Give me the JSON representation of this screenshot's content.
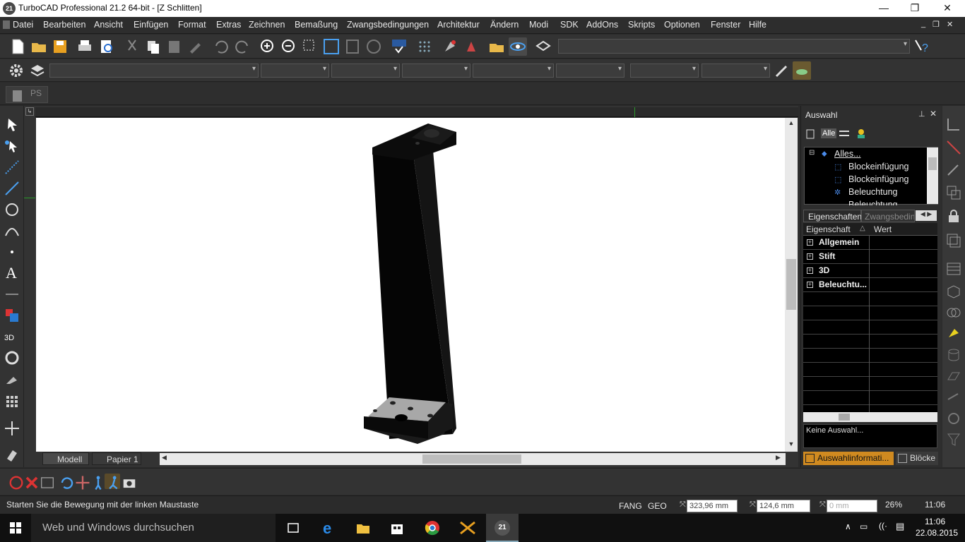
{
  "window": {
    "title": "TurboCAD Professional 21.2 64-bit - [Z Schlitten]",
    "app_icon_text": "21"
  },
  "menu": [
    "Datei",
    "Bearbeiten",
    "Ansicht",
    "Einfügen",
    "Format",
    "Extras",
    "Zeichnen",
    "Bemaßung",
    "Zwangsbedingungen",
    "Architektur",
    "Ändern",
    "Modi",
    "SDK",
    "AddOns",
    "Skripts",
    "Optionen",
    "Fenster",
    "Hilfe"
  ],
  "toolbar3": {
    "ps_label": "PS"
  },
  "tabs": {
    "model": "Modell",
    "paper": "Papier 1"
  },
  "panel": {
    "title": "Auswahl",
    "filter_label": "Alle",
    "tree": [
      "Alles...",
      "Blockeinfügung",
      "Blockeinfügung",
      "Beleuchtung",
      "Beleuchtung"
    ],
    "prop_tabs": [
      "Eigenschaften",
      "Zwangsbeding"
    ],
    "col_property": "Eigenschaft",
    "col_value": "Wert",
    "groups": [
      "Allgemein",
      "Stift",
      "3D",
      "Beleuchtu..."
    ],
    "info_text": "Keine Auswahl...",
    "bottom_tab_info": "Auswahlinformati...",
    "bottom_tab_blocks": "Blöcke"
  },
  "status": {
    "message": "Starten Sie die Bewegung mit der linken Maustaste",
    "snap": "FANG",
    "geo": "GEO",
    "x": "323,96 mm",
    "y": "124,6 mm",
    "z": "0 mm",
    "zoom": "26%",
    "time": "11:06"
  },
  "taskbar": {
    "search_placeholder": "Web und Windows durchsuchen",
    "clock_time": "11:06",
    "clock_date": "22.08.2015"
  },
  "colors": {
    "accent_orange": "#e8a020",
    "canvas": "#ffffff",
    "panel_bg": "#2e2e2e"
  }
}
